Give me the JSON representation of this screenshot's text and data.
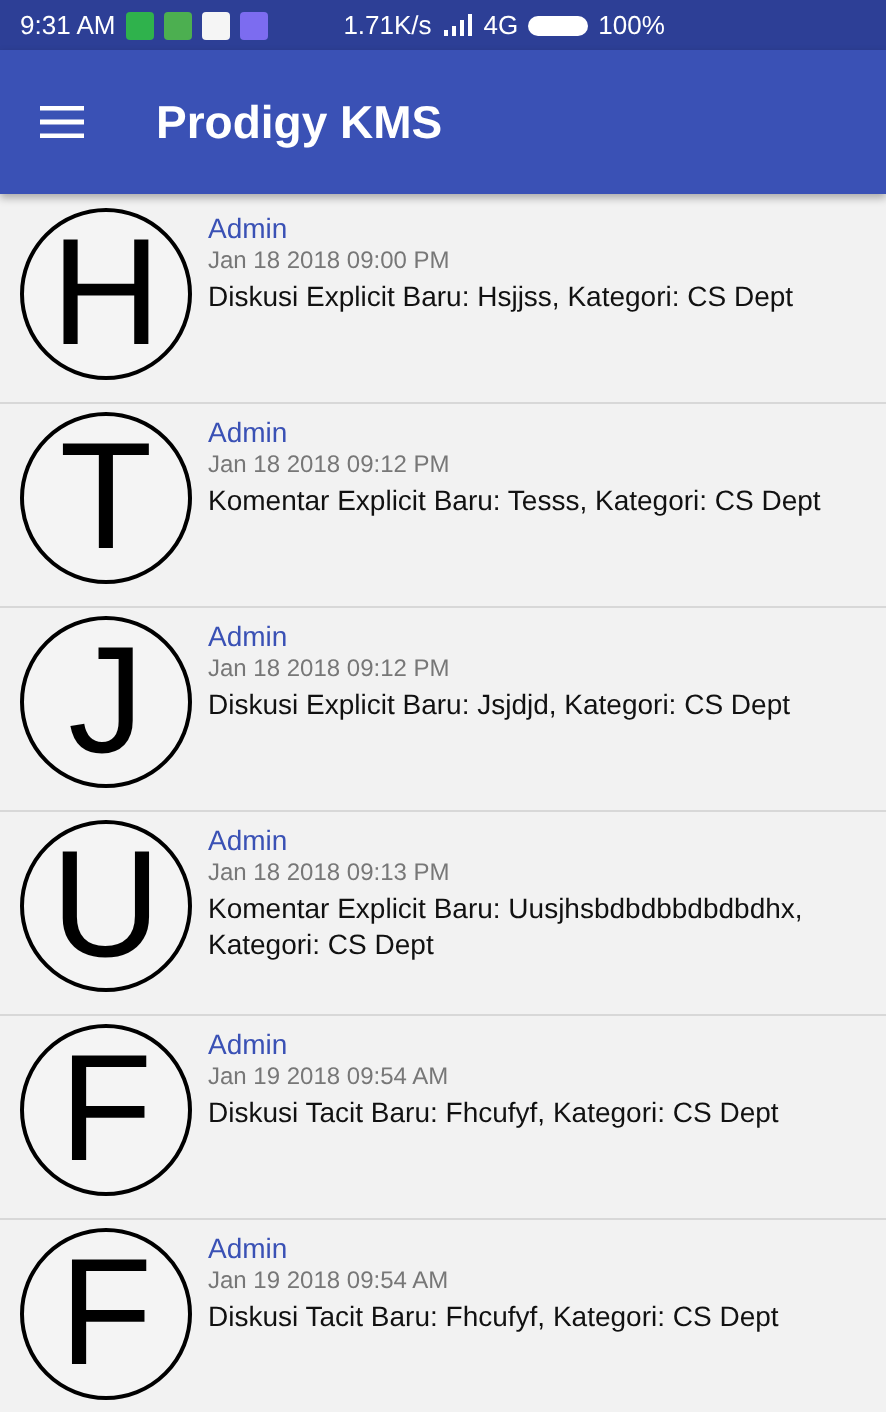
{
  "status_bar": {
    "time": "9:31 AM",
    "speed": "1.71K/s",
    "network": "4G",
    "battery": "100%"
  },
  "app_bar": {
    "title": "Prodigy KMS"
  },
  "notifications": [
    {
      "initial": "H",
      "author": "Admin",
      "date": "Jan 18 2018 09:00 PM",
      "message": "Diskusi Explicit Baru: Hsjjss, Kategori: CS Dept"
    },
    {
      "initial": "T",
      "author": "Admin",
      "date": "Jan 18 2018 09:12 PM",
      "message": "Komentar Explicit Baru: Tesss, Kategori: CS Dept"
    },
    {
      "initial": "J",
      "author": "Admin",
      "date": "Jan 18 2018 09:12 PM",
      "message": "Diskusi Explicit Baru: Jsjdjd, Kategori: CS Dept"
    },
    {
      "initial": "U",
      "author": "Admin",
      "date": "Jan 18 2018 09:13 PM",
      "message": "Komentar Explicit Baru: Uusjhsbdbdbbdbdbdhx, Kategori: CS Dept"
    },
    {
      "initial": "F",
      "author": "Admin",
      "date": "Jan 19 2018 09:54 AM",
      "message": "Diskusi Tacit Baru: Fhcufyf, Kategori: CS Dept"
    },
    {
      "initial": "F",
      "author": "Admin",
      "date": "Jan 19 2018 09:54 AM",
      "message": "Diskusi Tacit Baru: Fhcufyf, Kategori: CS Dept"
    }
  ]
}
